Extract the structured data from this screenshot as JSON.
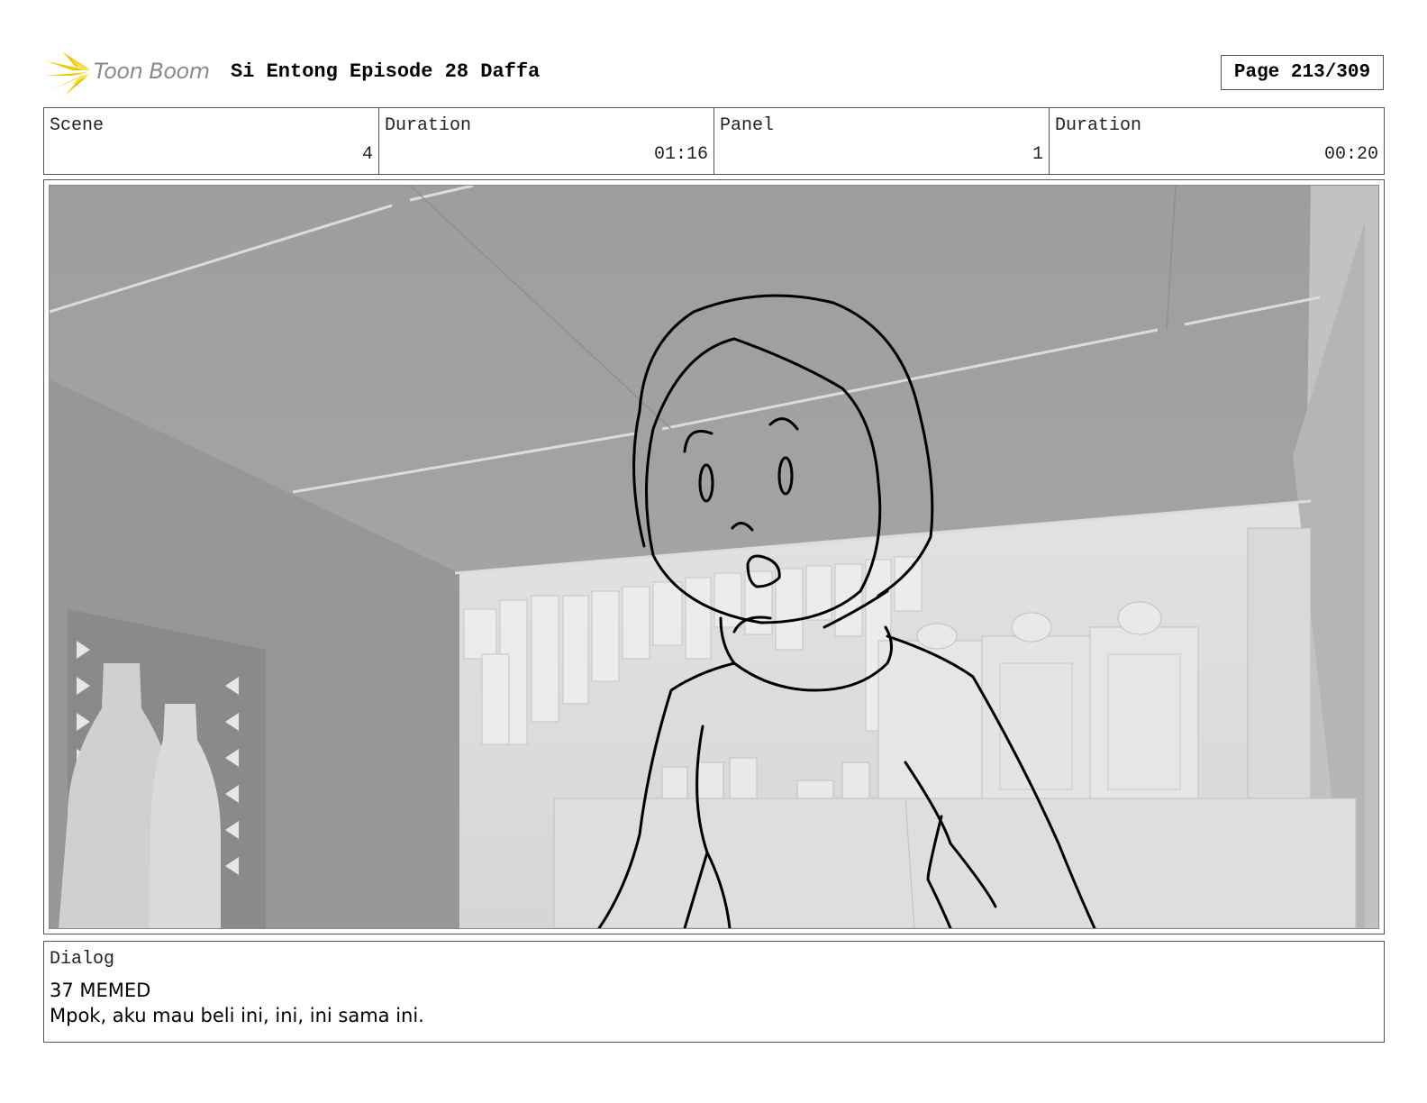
{
  "header": {
    "logo_text": "Toon Boom",
    "title": "Si Entong Episode 28 Daffa",
    "page": "Page 213/309"
  },
  "info": {
    "scene_label": "Scene",
    "scene_value": "4",
    "scene_duration_label": "Duration",
    "scene_duration_value": "01:16",
    "panel_label": "Panel",
    "panel_value": "1",
    "panel_duration_label": "Duration",
    "panel_duration_value": "00:20"
  },
  "dialog": {
    "label": "Dialog",
    "speaker": "37 MEMED",
    "line": "Mpok, aku mau beli ini, ini, ini sama ini."
  },
  "colors": {
    "logo_accent": "#f5c400",
    "border": "#555555"
  }
}
